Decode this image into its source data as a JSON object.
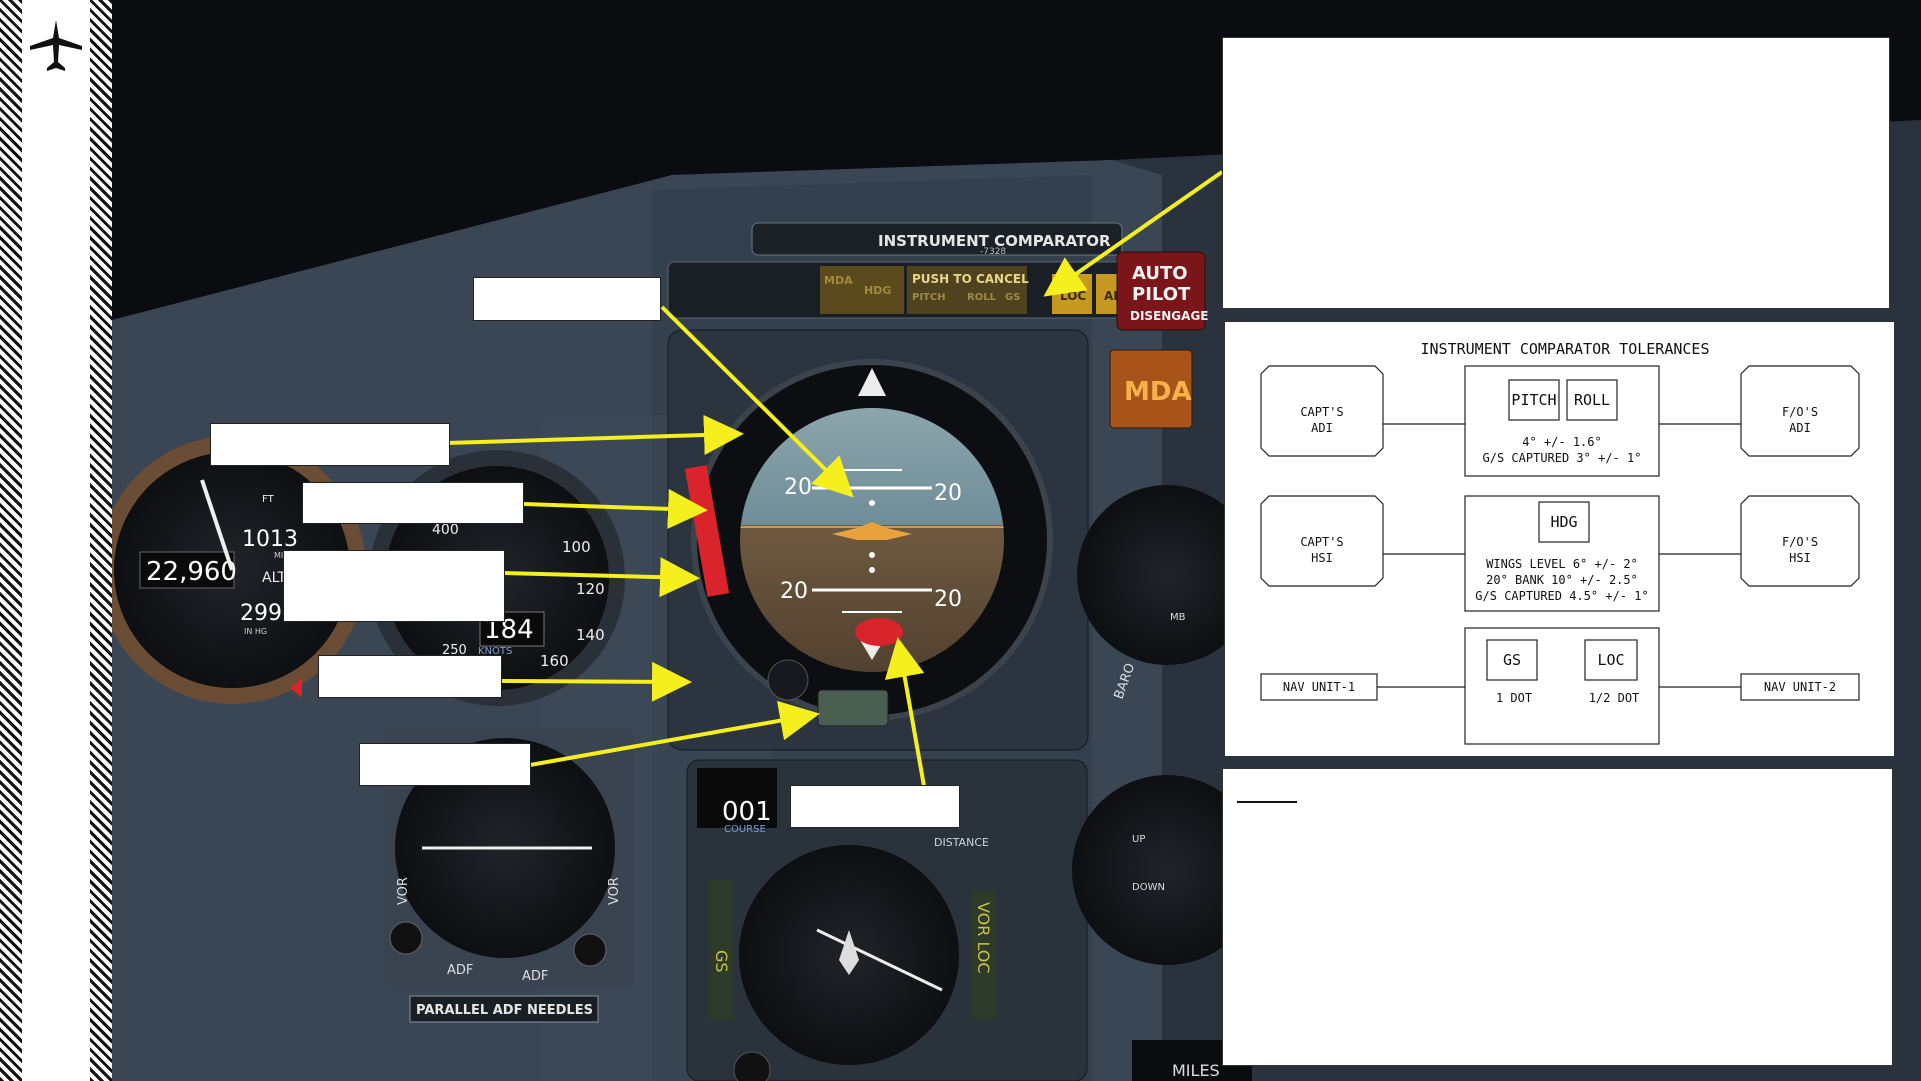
{
  "scene": {
    "comparator_title": "INSTRUMENT COMPARATOR",
    "comparator_code": "-7328",
    "annunciators": [
      "MDA",
      "HDG",
      "PUSH TO CANCEL",
      "PITCH",
      "ROLL",
      "GS",
      "LOC",
      "ALT"
    ],
    "autopilot_label": [
      "AUTO",
      "PILOT",
      "DISENGAGE"
    ],
    "mda_label": "MDA",
    "adi_pitch_marks": [
      "20",
      "20",
      "20",
      "20"
    ],
    "altimeter_text": [
      "FT",
      "1013",
      "MILLIBARS",
      "22,960",
      "ALT",
      "2992",
      "IN HG"
    ],
    "airspeed_text": [
      "400",
      "100",
      "120",
      "140",
      "160",
      "250",
      "KNOTS",
      "184"
    ],
    "hsi_course_value": "001",
    "hsi_course_label": "COURSE",
    "hsi_distance_label": "DISTANCE",
    "hsi_side_left": "GS",
    "hsi_side_right": "VOR LOC",
    "rmi_labels": [
      "ADF",
      "ADF",
      "VOR",
      "VOR"
    ],
    "rmi_placard": "PARALLEL ADF NEEDLES",
    "right_edge_text": [
      "BARO",
      "MB",
      "UP",
      "DOWN",
      "MILES"
    ]
  },
  "tolerances": {
    "title": "INSTRUMENT COMPARATOR TOLERANCES",
    "capt_adi": [
      "CAPT'S",
      "ADI"
    ],
    "capt_hsi": [
      "CAPT'S",
      "HSI"
    ],
    "fo_adi": [
      "F/O'S",
      "ADI"
    ],
    "fo_hsi": [
      "F/O'S",
      "HSI"
    ],
    "nav_unit_1": "NAV UNIT-1",
    "nav_unit_2": "NAV UNIT-2",
    "pitch": "PITCH",
    "roll": "ROLL",
    "pitch_roll_lines": [
      "4° +/- 1.6°",
      "G/S CAPTURED 3° +/- 1°"
    ],
    "hdg": "HDG",
    "hdg_lines": [
      "WINGS LEVEL 6° +/- 2°",
      "20° BANK 10° +/- 2.5°",
      "G/S CAPTURED 4.5° +/- 1°"
    ],
    "gs": "GS",
    "gs_value": "1 DOT",
    "loc": "LOC",
    "loc_value": "1/2 DOT"
  },
  "colors": {
    "callout_arrow": "#f5ef1e",
    "panel_gray": "#3c4a58",
    "warn_red": "#d8242a",
    "annunciator_amber": "#c69a22"
  }
}
